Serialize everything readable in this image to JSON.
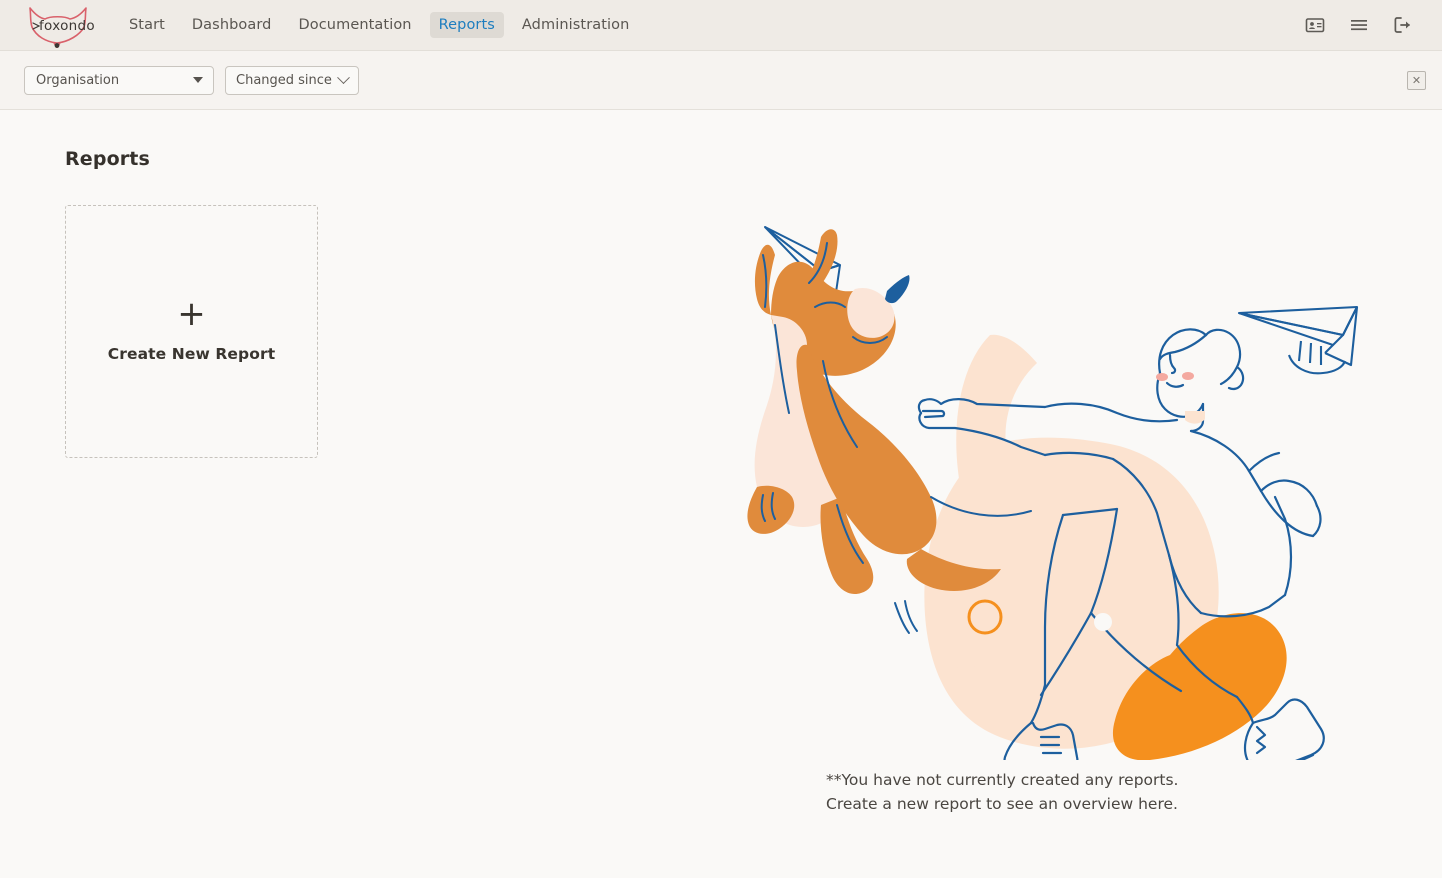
{
  "brand": {
    "name": "foxondo",
    "logo_color": "#d9616b"
  },
  "nav": {
    "items": [
      {
        "label": "Start",
        "active": false
      },
      {
        "label": "Dashboard",
        "active": false
      },
      {
        "label": "Documentation",
        "active": false
      },
      {
        "label": "Reports",
        "active": true
      },
      {
        "label": "Administration",
        "active": false
      }
    ],
    "active_color": "#1d7dbf",
    "active_bg": "#dedad4"
  },
  "topbar_icons": [
    {
      "name": "contact-card-icon"
    },
    {
      "name": "hamburger-menu-icon"
    },
    {
      "name": "logout-icon"
    }
  ],
  "filterbar": {
    "organisation_select": {
      "value": "Organisation",
      "icon": "caret-down-icon"
    },
    "changed_since_chip": {
      "label": "Changed since",
      "icon": "chevron-down-icon"
    },
    "clear_button": {
      "glyph": "✕",
      "icon": "close-box-icon"
    }
  },
  "main": {
    "page_title": "Reports",
    "create_card": {
      "plus": "+",
      "label": "Create New Report"
    },
    "empty_state": {
      "line1": "**You have not currently created any reports.",
      "line2": "Create a new report to see an overview here."
    },
    "illustration": {
      "name": "person-throwing-paper-plane-with-fox",
      "line_color": "#1d5f9e",
      "fox_color": "#e08b3c",
      "tail_color": "#f5901e",
      "blob_color": "#fce3d0",
      "cheek_color": "#f4a9a0"
    }
  },
  "colors": {
    "header_bg": "#efebe6",
    "filterbar_bg": "#f6f3f0",
    "content_bg": "#faf9f7",
    "text": "#5a5651"
  }
}
